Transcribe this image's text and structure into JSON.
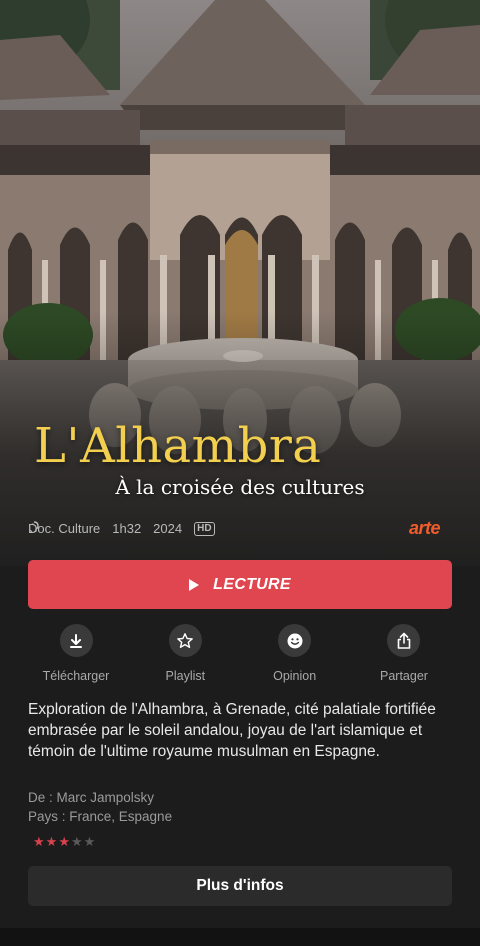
{
  "program": {
    "title": "L'Alhambra",
    "subtitle": "À la croisée des cultures",
    "genre": "Doc. Culture",
    "duration": "1h32",
    "year": "2024",
    "quality_badge": "HD",
    "audio_description_icon": "audio-description-icon",
    "channel": "arte"
  },
  "play_button": {
    "label": "LECTURE",
    "icon": "play-icon"
  },
  "actions": [
    {
      "label": "Télécharger",
      "icon": "download-icon"
    },
    {
      "label": "Playlist",
      "icon": "star-outline-icon"
    },
    {
      "label": "Opinion",
      "icon": "smiley-icon"
    },
    {
      "label": "Partager",
      "icon": "share-icon"
    }
  ],
  "description": "Exploration de l'Alhambra, à Grenade, cité palatiale fortifiée embrasée par le soleil andalou, joyau de l'art islamique et témoin de l'ultime royaume musulman en Espagne.",
  "credits": {
    "director": "De : Marc Jampolsky",
    "countries": "Pays : France, Espagne"
  },
  "rating": {
    "value": 3,
    "max": 5
  },
  "more_info_button": {
    "label": "Plus d'infos"
  },
  "colors": {
    "accent": "#e0464f",
    "title_gold": "#f2cf4e",
    "brand_orange": "#f25c2b",
    "background": "#1c1c1c"
  }
}
